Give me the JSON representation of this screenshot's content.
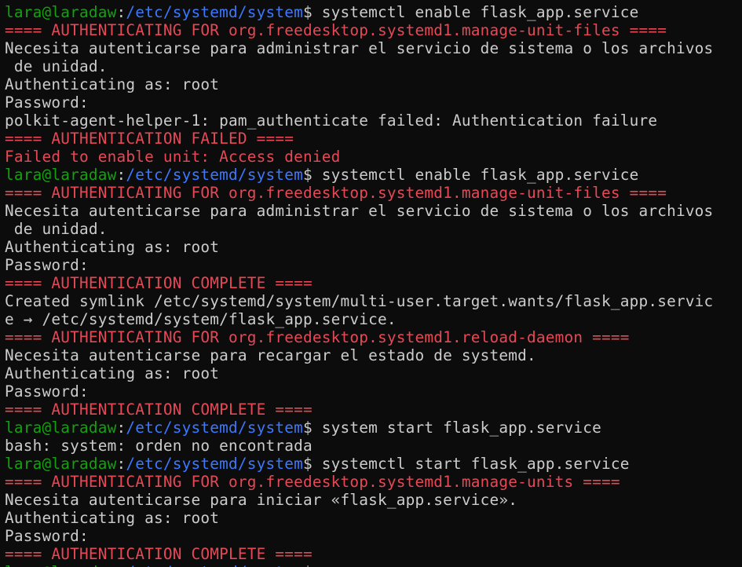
{
  "terminal": {
    "prompt_user": "lara@laradaw",
    "prompt_colon": ":",
    "prompt_path": "/etc/systemd/system",
    "prompt_symbol": "$",
    "lines": [
      {
        "type": "prompt",
        "cmd": " systemctl enable flask_app.service"
      },
      {
        "type": "red",
        "text": "==== AUTHENTICATING FOR org.freedesktop.systemd1.manage-unit-files ===="
      },
      {
        "type": "out",
        "text": "Necesita autenticarse para administrar el servicio de sistema o los archivos"
      },
      {
        "type": "out",
        "text": " de unidad."
      },
      {
        "type": "out",
        "text": "Authenticating as: root"
      },
      {
        "type": "out",
        "text": "Password:"
      },
      {
        "type": "out",
        "text": "polkit-agent-helper-1: pam_authenticate failed: Authentication failure"
      },
      {
        "type": "red",
        "text": "==== AUTHENTICATION FAILED ===="
      },
      {
        "type": "red",
        "text": "Failed to enable unit: Access denied"
      },
      {
        "type": "prompt",
        "cmd": " systemctl enable flask_app.service"
      },
      {
        "type": "red",
        "text": "==== AUTHENTICATING FOR org.freedesktop.systemd1.manage-unit-files ===="
      },
      {
        "type": "out",
        "text": "Necesita autenticarse para administrar el servicio de sistema o los archivos"
      },
      {
        "type": "out",
        "text": " de unidad."
      },
      {
        "type": "out",
        "text": "Authenticating as: root"
      },
      {
        "type": "out",
        "text": "Password:"
      },
      {
        "type": "red",
        "text": "==== AUTHENTICATION COMPLETE ===="
      },
      {
        "type": "out",
        "text": "Created symlink /etc/systemd/system/multi-user.target.wants/flask_app.servic"
      },
      {
        "type": "out",
        "text": "e → /etc/systemd/system/flask_app.service."
      },
      {
        "type": "red",
        "text": "==== AUTHENTICATING FOR org.freedesktop.systemd1.reload-daemon ===="
      },
      {
        "type": "out",
        "text": "Necesita autenticarse para recargar el estado de systemd."
      },
      {
        "type": "out",
        "text": "Authenticating as: root"
      },
      {
        "type": "out",
        "text": "Password:"
      },
      {
        "type": "red",
        "text": "==== AUTHENTICATION COMPLETE ===="
      },
      {
        "type": "prompt",
        "cmd": " system start flask_app.service"
      },
      {
        "type": "out",
        "text": "bash: system: orden no encontrada"
      },
      {
        "type": "prompt",
        "cmd": " systemctl start flask_app.service"
      },
      {
        "type": "red",
        "text": "==== AUTHENTICATING FOR org.freedesktop.systemd1.manage-units ===="
      },
      {
        "type": "out",
        "text": "Necesita autenticarse para iniciar «flask_app.service»."
      },
      {
        "type": "out",
        "text": "Authenticating as: root"
      },
      {
        "type": "out",
        "text": "Password:"
      },
      {
        "type": "red",
        "text": "==== AUTHENTICATION COMPLETE ===="
      },
      {
        "type": "prompt",
        "cmd": ""
      }
    ]
  },
  "colors": {
    "background": "#0c0c0c",
    "text": "#cccccc",
    "prompt_user": "#13a10e",
    "prompt_path": "#3b78ff",
    "error_red": "#e74856"
  }
}
